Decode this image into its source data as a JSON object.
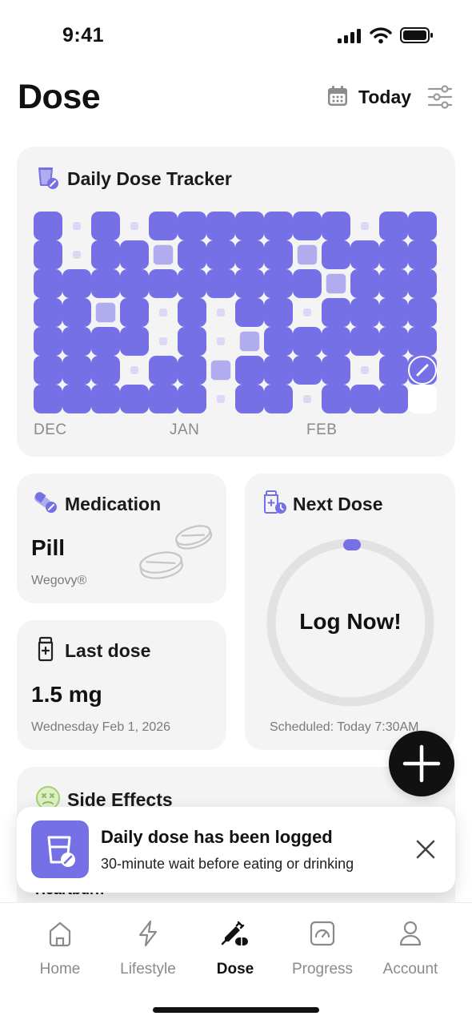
{
  "status": {
    "time": "9:41"
  },
  "header": {
    "title": "Dose",
    "date_label": "Today"
  },
  "tracker": {
    "title": "Daily Dose Tracker",
    "months": [
      "DEC",
      "JAN",
      "FEB"
    ],
    "grid_legend": {
      "F": "dose logged",
      "H": "partial",
      "D": "no dose",
      "T": "today"
    },
    "grid": [
      "FDFDFFFFFFFDFF",
      "FDFFHFFFFHFFFF",
      "FFFFFFFFFFHFFF",
      "FFHFDFDFFDFFFF",
      "FFFFDFDHFFFFFF",
      "FFFDFFHFFFFDFF",
      "FFFFFFDFFDFFFT"
    ]
  },
  "medication": {
    "title": "Medication",
    "value": "Pill",
    "brand": "Wegovy®"
  },
  "last_dose": {
    "title": "Last dose",
    "value": "1.5 mg",
    "date": "Wednesday Feb 1, 2026"
  },
  "next_dose": {
    "title": "Next Dose",
    "action": "Log Now!",
    "scheduled": "Scheduled: Today 7:30AM",
    "progress": 0.0
  },
  "side_effects": {
    "title": "Side Effects",
    "partial_item": "Heartburn"
  },
  "toast": {
    "title": "Daily dose has been logged",
    "message": "30-minute wait before eating or drinking"
  },
  "nav": {
    "items": [
      {
        "label": "Home",
        "icon": "home-icon",
        "active": false
      },
      {
        "label": "Lifestyle",
        "icon": "lightning-icon",
        "active": false
      },
      {
        "label": "Dose",
        "icon": "syringe-pill-icon",
        "active": true
      },
      {
        "label": "Progress",
        "icon": "gauge-icon",
        "active": false
      },
      {
        "label": "Account",
        "icon": "user-icon",
        "active": false
      }
    ]
  },
  "colors": {
    "accent": "#7670E6",
    "accent_light": "#B0ACED",
    "dot": "#DAD9F5",
    "card_bg": "#F4F4F5"
  }
}
